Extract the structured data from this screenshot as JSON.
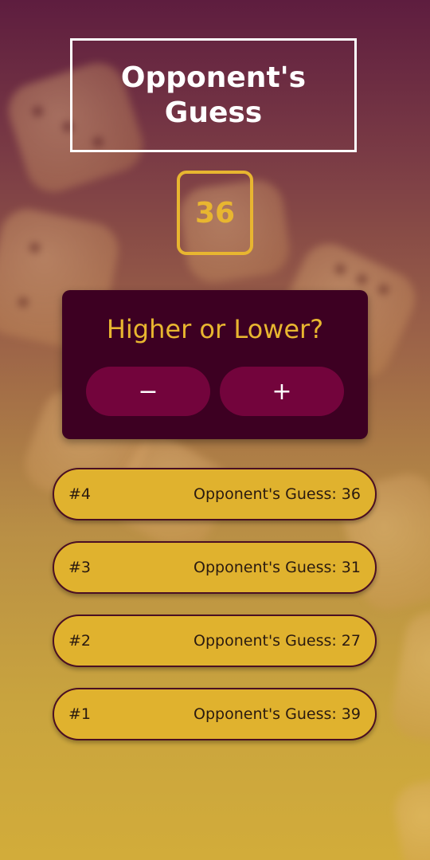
{
  "header": {
    "title": "Opponent's Guess"
  },
  "current_guess": "36",
  "prompt": {
    "title": "Higher or Lower?",
    "minus_label": "−",
    "plus_label": "+"
  },
  "guesses": [
    {
      "index": "#4",
      "text": "Opponent's Guess: 36"
    },
    {
      "index": "#3",
      "text": "Opponent's Guess: 31"
    },
    {
      "index": "#2",
      "text": "Opponent's Guess: 27"
    },
    {
      "index": "#1",
      "text": "Opponent's Guess: 39"
    }
  ],
  "colors": {
    "accent": "#e8b630",
    "panel": "#3d0022",
    "button": "#73043c",
    "list_item": "#e0b22e",
    "list_border": "#4a0f23"
  }
}
